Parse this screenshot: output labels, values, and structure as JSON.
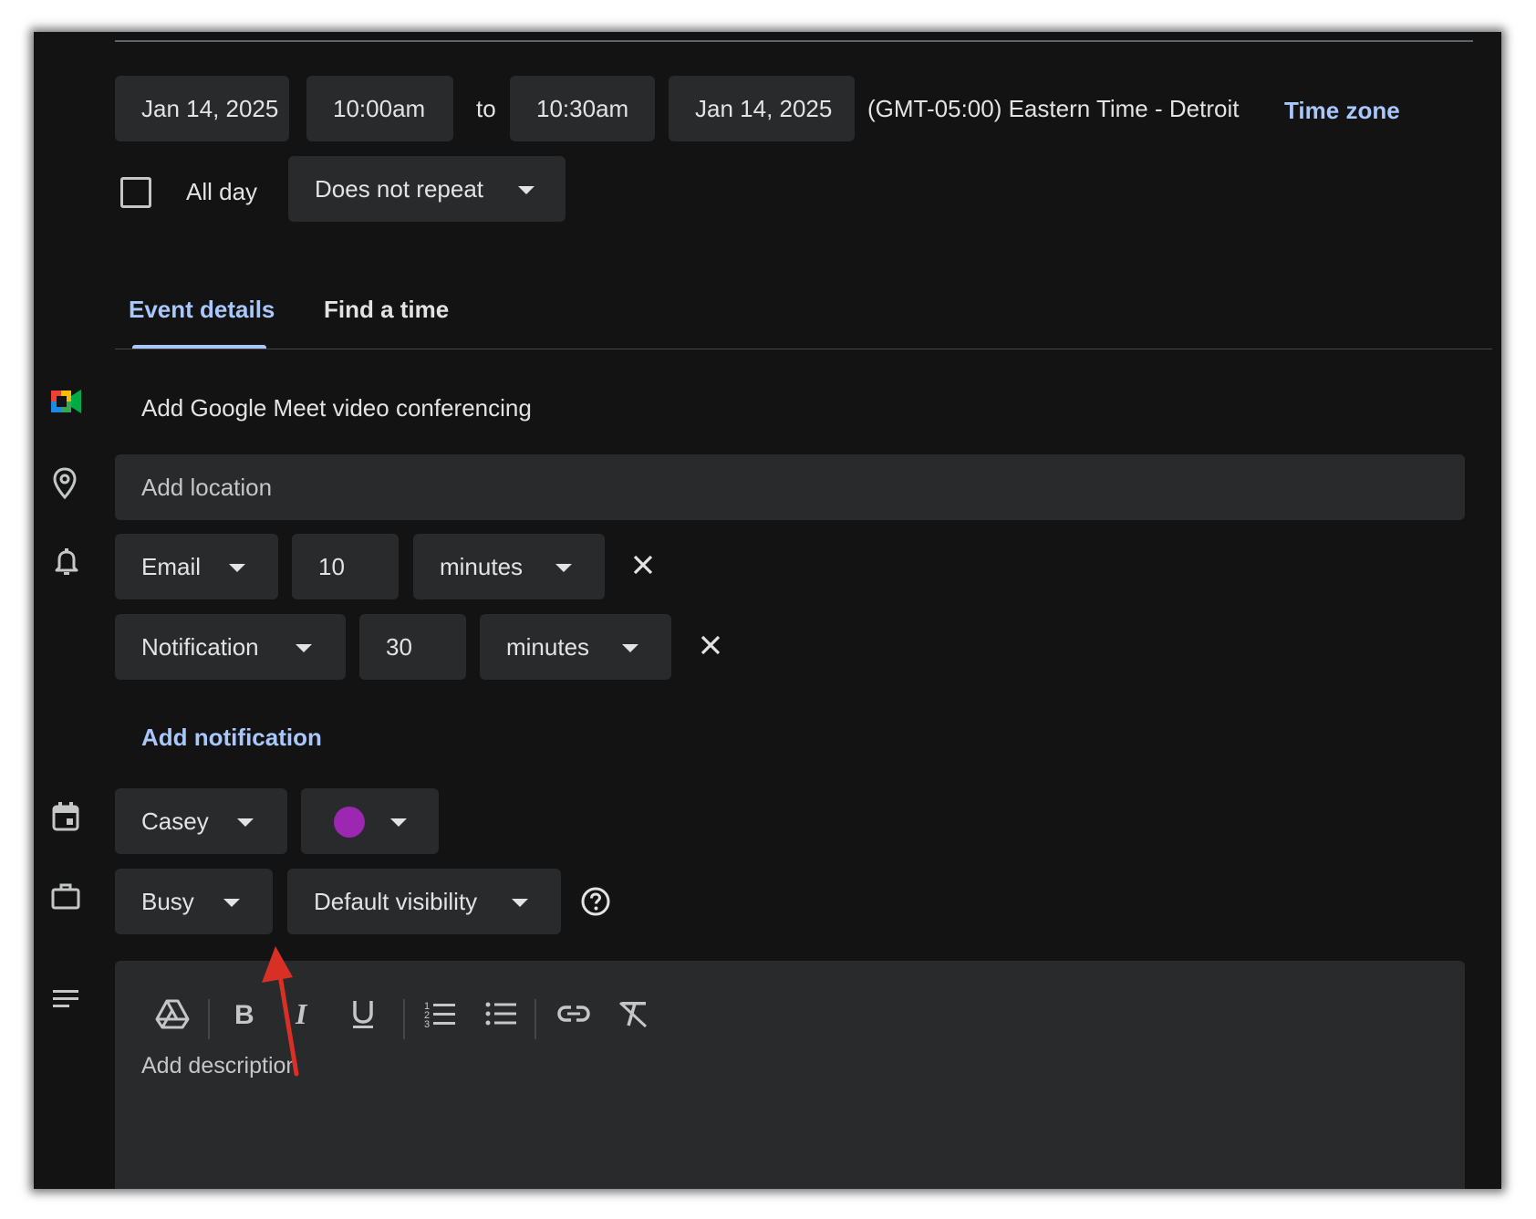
{
  "datetime": {
    "start_date": "Jan 14, 2025",
    "start_time": "10:00am",
    "to_label": "to",
    "end_time": "10:30am",
    "end_date": "Jan 14, 2025",
    "timezone_text": "(GMT-05:00) Eastern Time - Detroit",
    "timezone_link": "Time zone"
  },
  "allday": {
    "label": "All day",
    "checked": false,
    "repeat_value": "Does not repeat"
  },
  "tabs": [
    {
      "label": "Event details",
      "active": true
    },
    {
      "label": "Find a time",
      "active": false
    }
  ],
  "meet": {
    "label": "Add Google Meet video conferencing"
  },
  "location": {
    "placeholder": "Add location"
  },
  "notifications": [
    {
      "type": "Email",
      "amount": "10",
      "unit": "minutes"
    },
    {
      "type": "Notification",
      "amount": "30",
      "unit": "minutes"
    }
  ],
  "add_notification": "Add notification",
  "calendar": {
    "owner": "Casey",
    "color": "#9c27b0"
  },
  "availability": {
    "status": "Busy",
    "visibility": "Default visibility"
  },
  "description": {
    "placeholder": "Add description"
  },
  "toolbar": {
    "items": [
      "drive-icon",
      "bold-icon",
      "italic-icon",
      "underline-icon",
      "numbered-list-icon",
      "bulleted-list-icon",
      "link-icon",
      "clear-formatting-icon"
    ]
  },
  "colors": {
    "background": "#131314",
    "field": "#282a2c",
    "accent": "#a8c7fa",
    "text": "#e3e3e3",
    "annotation_arrow": "#d93025"
  }
}
